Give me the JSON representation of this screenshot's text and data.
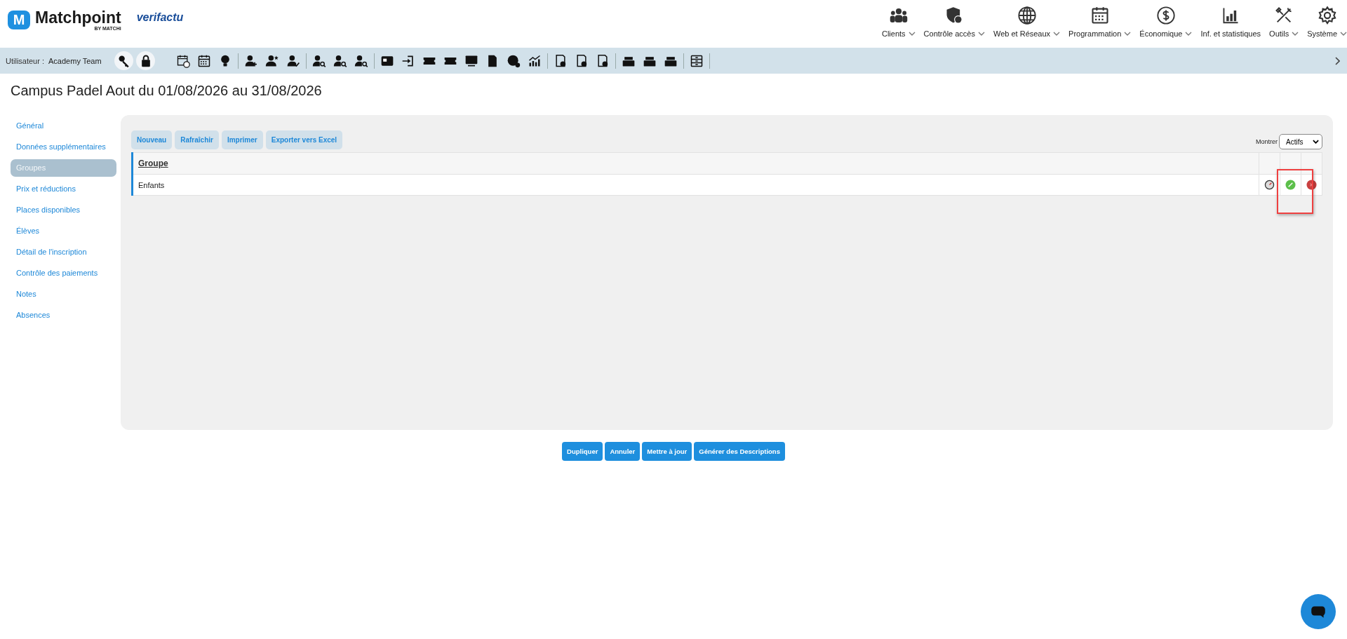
{
  "logo": {
    "name": "Matchpoint",
    "mark": "M",
    "byline": "BY MATCHi",
    "partner": "verifactu"
  },
  "menu": [
    {
      "label": "Clients",
      "dropdown": true
    },
    {
      "label": "Contrôle accès",
      "dropdown": true
    },
    {
      "label": "Web et Réseaux",
      "dropdown": true
    },
    {
      "label": "Programmation",
      "dropdown": true
    },
    {
      "label": "Économique",
      "dropdown": true
    },
    {
      "label": "Inf. et statistiques",
      "dropdown": false
    },
    {
      "label": "Outils",
      "dropdown": true
    },
    {
      "label": "Système",
      "dropdown": true
    }
  ],
  "user_bar": {
    "label": "Utilisateur :",
    "user": "Academy Team"
  },
  "page_title": "Campus Padel Aout du 01/08/2026 au 31/08/2026",
  "sidebar": [
    {
      "label": "Général",
      "selected": false
    },
    {
      "label": "Données supplémentaires",
      "selected": false
    },
    {
      "label": "Groupes",
      "selected": true
    },
    {
      "label": "Prix et réductions",
      "selected": false
    },
    {
      "label": "Places disponibles",
      "selected": false
    },
    {
      "label": "Élèves",
      "selected": false
    },
    {
      "label": "Détail de l'inscription",
      "selected": false
    },
    {
      "label": "Contrôle des paiements",
      "selected": false
    },
    {
      "label": "Notes",
      "selected": false
    },
    {
      "label": "Absences",
      "selected": false
    }
  ],
  "actions": [
    "Nouveau",
    "Rafraîchir",
    "Imprimer",
    "Exporter vers Excel"
  ],
  "filter": {
    "label": "Montrer",
    "value": "Actifs"
  },
  "table": {
    "columns": [
      "Groupe"
    ],
    "rows": [
      {
        "name": "Enfants"
      }
    ]
  },
  "footer_buttons": [
    "Dupliquer",
    "Annuler",
    "Mettre à jour",
    "Générer des Descriptions"
  ]
}
